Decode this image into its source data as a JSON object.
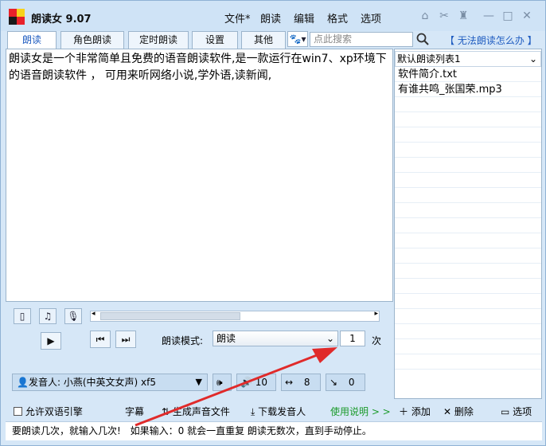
{
  "app": {
    "title": "朗读女 9.07"
  },
  "menu": [
    "文件*",
    "朗读",
    "编辑",
    "格式",
    "选项"
  ],
  "tabs": [
    "朗读",
    "角色朗读",
    "定时朗读",
    "设置",
    "其他"
  ],
  "search": {
    "placeholder": "点此搜索"
  },
  "help_link": "【 无法朗读怎么办 】",
  "editor": {
    "text": "朗读女是一个非常简单且免费的语音朗读软件,是一款运行在win7、xp环境下的语音朗读软件 ， 可用来听网络小说,学外语,读新闻,"
  },
  "playlist": {
    "name": "默认朗读列表1",
    "items": [
      "软件简介.txt",
      "有谁共鸣_张国荣.mp3"
    ]
  },
  "controls": {
    "mode_label": "朗读模式:",
    "mode_value": "朗读",
    "count_value": "1",
    "count_unit": "次",
    "voice_label": "发音人: 小燕(中英文女声) xf5",
    "volume": "10",
    "speed": "8",
    "pitch": "0"
  },
  "bottom": {
    "dual_engine": "允许双语引擎",
    "subtitle": "字幕",
    "generate": "生成声音文件",
    "download": "下载发音人",
    "usage": "使用说明 > >",
    "add": "添加",
    "delete": "删除",
    "options": "选项"
  },
  "status": {
    "left": "要朗读几次，就输入几次!",
    "right": "如果输入：0  就会一直重复 朗读无数次，直到手动停止。"
  },
  "colors": {
    "accent": "#1f5cc0",
    "arrow": "#e02a2a",
    "usage": "#1a9a2a"
  }
}
